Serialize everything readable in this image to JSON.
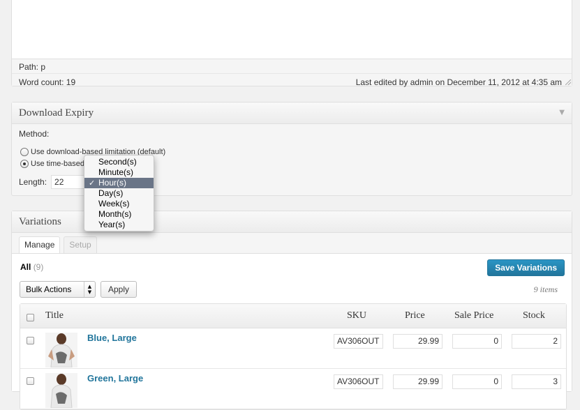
{
  "editor": {
    "path_label": "Path: p",
    "word_count": "Word count: 19",
    "last_edited": "Last edited by admin on December 11, 2012 at 4:35 am"
  },
  "expiry": {
    "title": "Download Expiry",
    "method_label": "Method:",
    "option_download": "Use download-based limitation (default)",
    "option_time": "Use time-based",
    "length_label": "Length:",
    "length_value": "22",
    "unit_options": [
      "Second(s)",
      "Minute(s)",
      "Hour(s)",
      "Day(s)",
      "Week(s)",
      "Month(s)",
      "Year(s)"
    ],
    "selected_unit": "Hour(s)"
  },
  "variations": {
    "title": "Variations",
    "tabs": [
      {
        "label": "Manage",
        "active": true
      },
      {
        "label": "Setup",
        "active": false
      }
    ],
    "filter_all": "All",
    "filter_count": "(9)",
    "save_label": "Save Variations",
    "bulk_label": "Bulk Actions",
    "apply_label": "Apply",
    "items_count": "9 items",
    "columns": {
      "title": "Title",
      "sku": "SKU",
      "price": "Price",
      "sale_price": "Sale Price",
      "stock": "Stock"
    },
    "rows": [
      {
        "name": "Blue, Large",
        "sku": "AV306OUT",
        "price": "29.99",
        "sale_price": "0",
        "stock": "2"
      },
      {
        "name": "Green, Large",
        "sku": "AV306OUT",
        "price": "29.99",
        "sale_price": "0",
        "stock": "3"
      }
    ]
  },
  "colors": {
    "accent": "#21759b",
    "menu_selected": "#6a7587"
  }
}
